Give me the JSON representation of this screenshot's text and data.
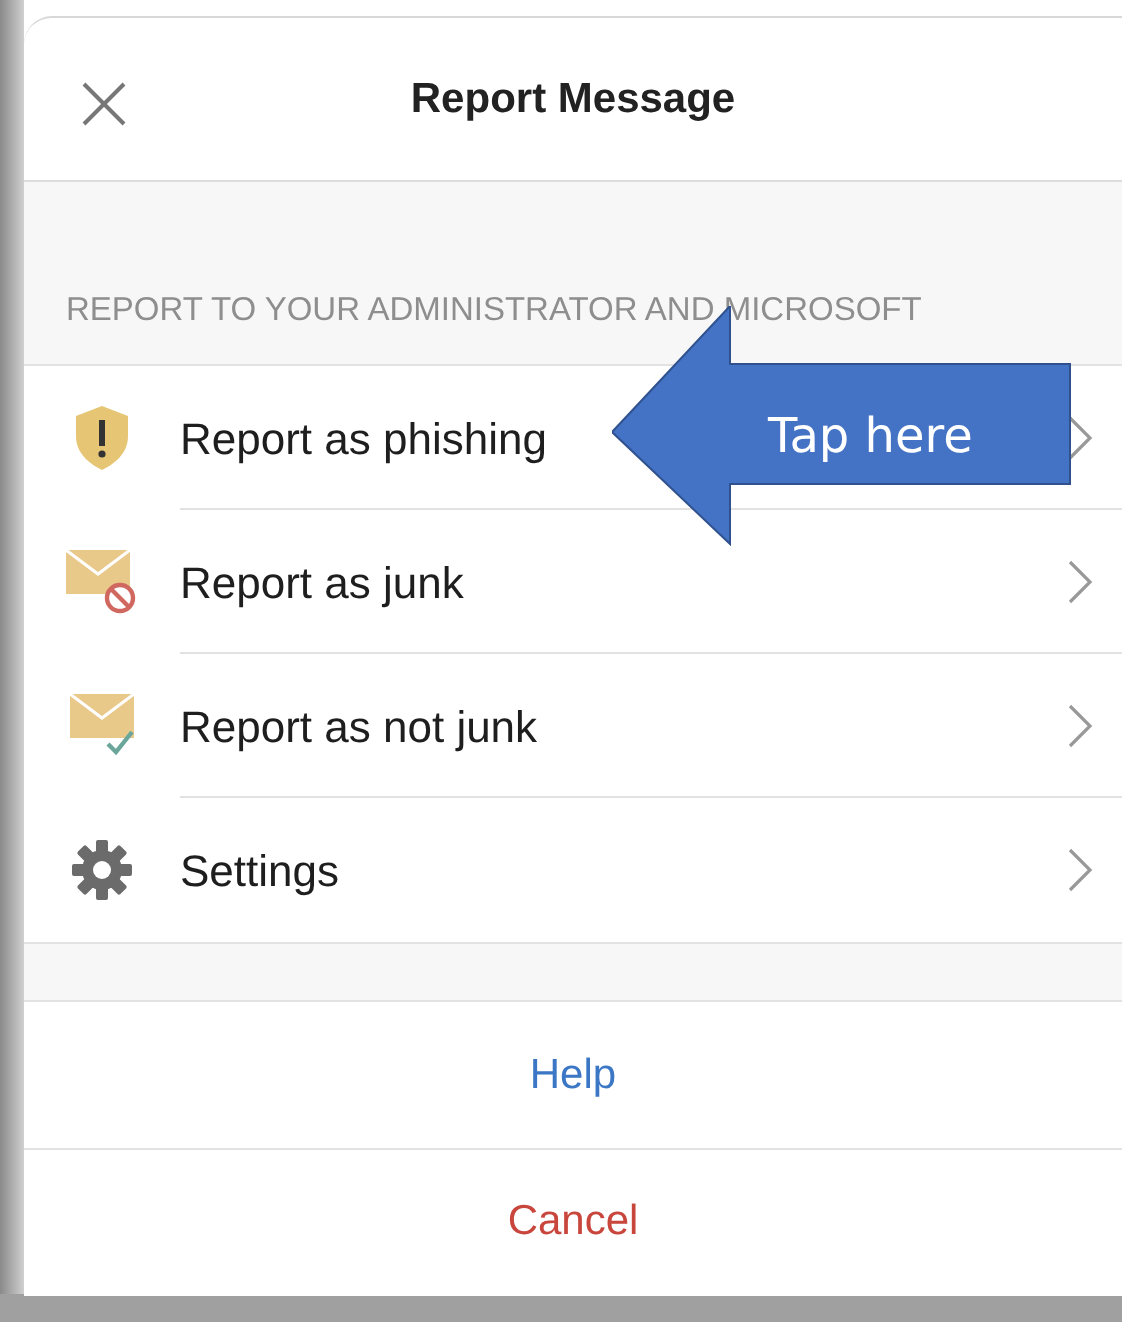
{
  "header": {
    "title": "Report Message"
  },
  "section": {
    "label": "REPORT TO YOUR ADMINISTRATOR AND MICROSOFT"
  },
  "items": [
    {
      "kind": "shield",
      "label": "Report as phishing"
    },
    {
      "kind": "junk",
      "label": "Report as junk"
    },
    {
      "kind": "notjunk",
      "label": "Report as not junk"
    },
    {
      "kind": "gear",
      "label": "Settings"
    }
  ],
  "actions": [
    {
      "kind": "help",
      "label": "Help"
    },
    {
      "kind": "cancel",
      "label": "Cancel"
    }
  ],
  "callout": {
    "text": "Tap here"
  }
}
